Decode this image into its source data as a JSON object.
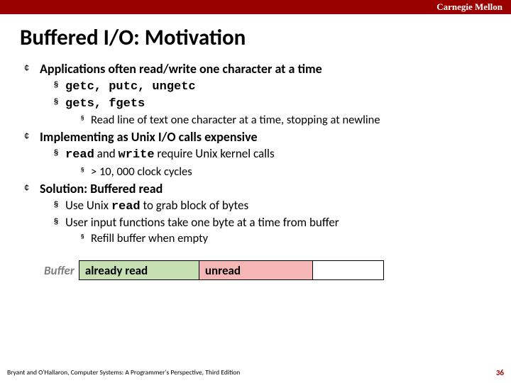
{
  "header": {
    "brand": "Carnegie Mellon"
  },
  "title": "Buffered I/O: Motivation",
  "points": [
    {
      "heading": "Applications often read/write one character at a time",
      "sub": [
        {
          "text_html": "<span class='mono'>getc, putc, ungetc</span>"
        },
        {
          "text_html": "<span class='mono'>gets, fgets</span>",
          "sub": [
            {
              "text": "Read line of text one character at a time, stopping at newline"
            }
          ]
        }
      ]
    },
    {
      "heading": "Implementing as Unix I/O calls expensive",
      "sub": [
        {
          "text_html": "<span class='mono'>read</span> and <span class='mono'>write</span> require Unix kernel calls",
          "sub": [
            {
              "text": "> 10, 000 clock cycles"
            }
          ]
        }
      ]
    },
    {
      "heading": "Solution: Buffered read",
      "sub": [
        {
          "text_html": "Use Unix <span class='mono'>read</span>  to grab block of bytes"
        },
        {
          "text_html": "User input functions take one byte at a time from buffer",
          "sub": [
            {
              "text": "Refill buffer when empty"
            }
          ]
        }
      ]
    }
  ],
  "buffer": {
    "label": "Buffer",
    "read": "already read",
    "unread": "unread"
  },
  "footer": {
    "citation": "Bryant and O'Hallaron, Computer Systems: A Programmer's Perspective, Third Edition",
    "page": "36"
  }
}
